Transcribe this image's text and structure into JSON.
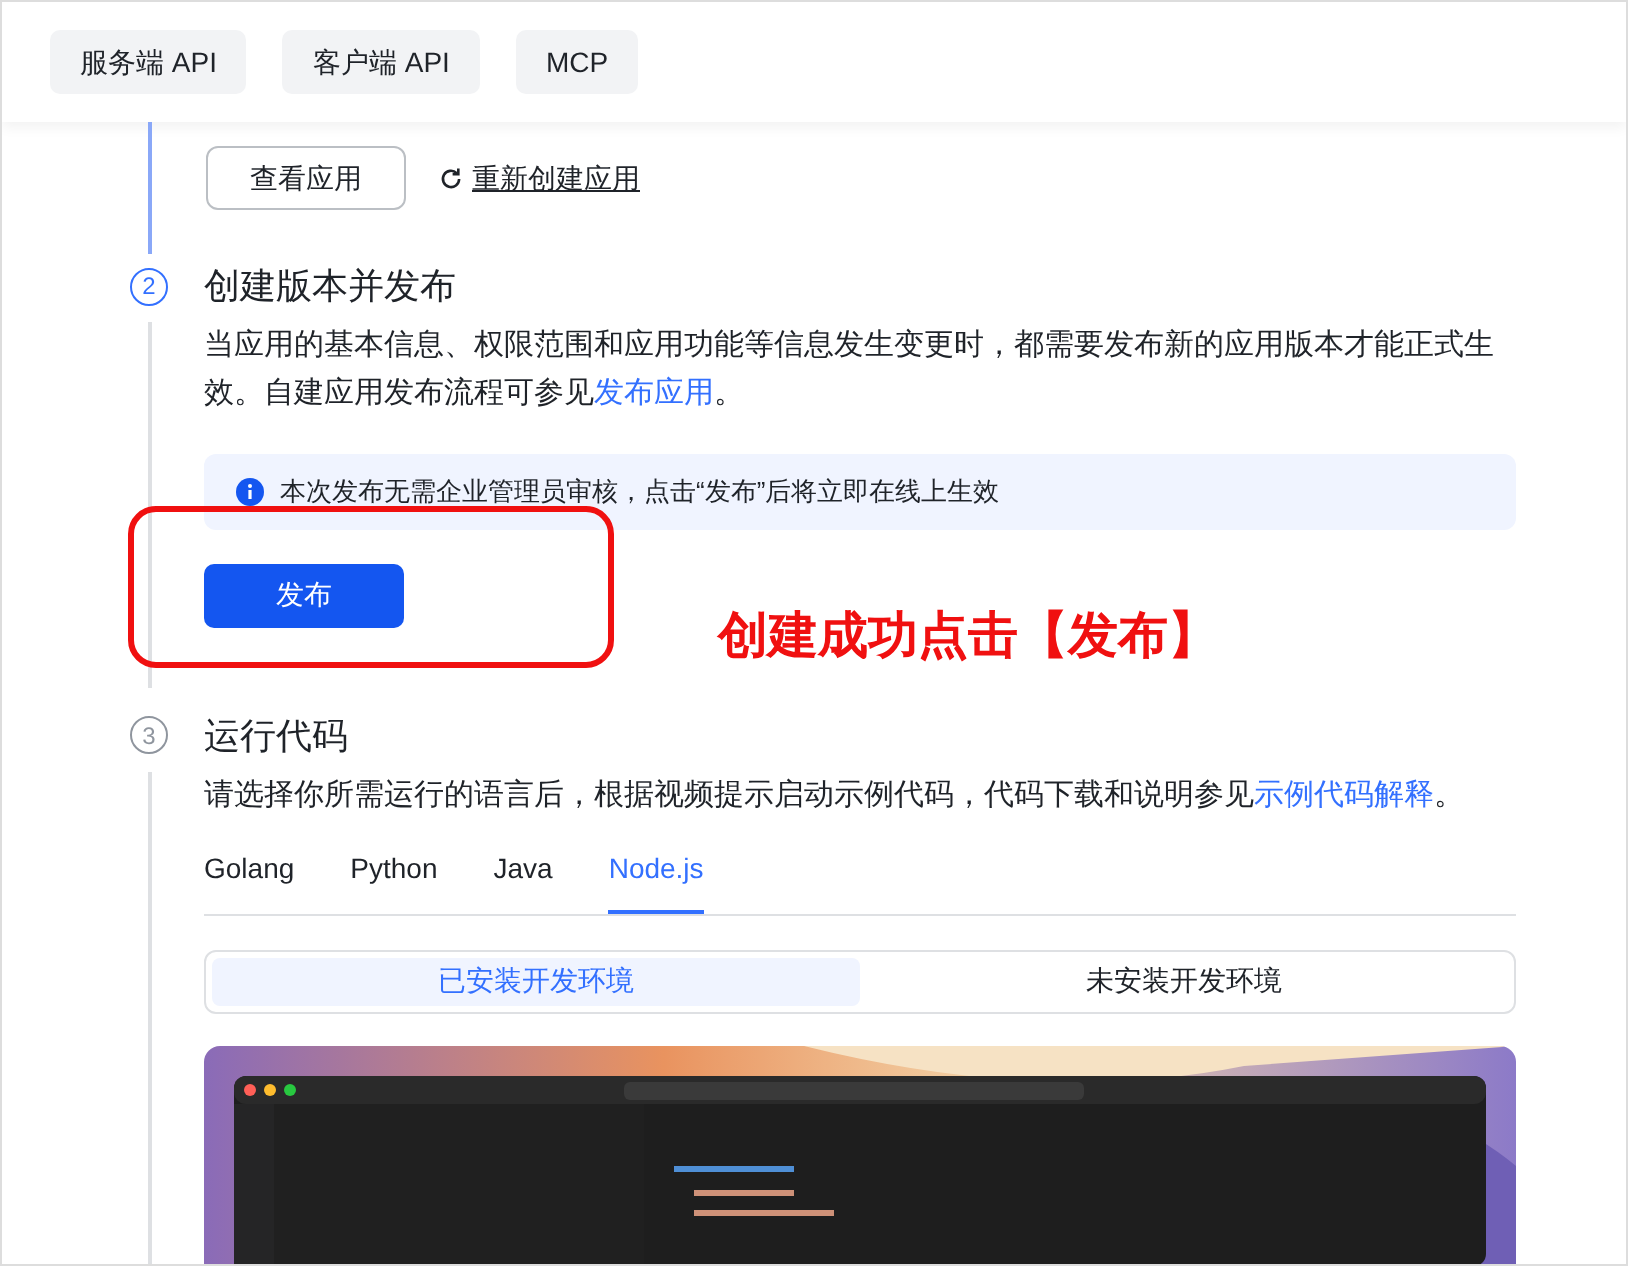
{
  "top_tabs": [
    {
      "label": "服务端 API",
      "selected": false
    },
    {
      "label": "客户端 API",
      "selected": false
    },
    {
      "label": "MCP",
      "selected": false
    }
  ],
  "step_1_tail": {
    "view_button": "查看应用",
    "recreate_link": "重新创建应用"
  },
  "steps": [
    {
      "number": "2",
      "active": true,
      "title": "创建版本并发布",
      "description": "当应用的基本信息、权限范围和应用功能等信息发生变更时，都需要发布新的应用版本才能正式生效。自建应用发布流程可参见",
      "link": "发布应用",
      "after": "。",
      "notice": "本次发布无需企业管理员审核，点击“发布”后将立即在线上生效",
      "publish_button": "发布"
    },
    {
      "number": "3",
      "active": false,
      "title": "运行代码",
      "description": "请选择你所需运行的语言后，根据视频提示启动示例代码，代码下载和说明参见",
      "link": "示例代码解释",
      "after": "。",
      "language_tabs": [
        {
          "label": "Golang",
          "selected": false
        },
        {
          "label": "Python",
          "selected": false
        },
        {
          "label": "Java",
          "selected": false
        },
        {
          "label": "Node.js",
          "selected": true
        }
      ],
      "env_tabs": [
        {
          "label": "已安装开发环境",
          "selected": true
        },
        {
          "label": "未安装开发环境",
          "selected": false
        }
      ],
      "video": {
        "kind": "picture"
      }
    }
  ],
  "annotation": {
    "text": "创建成功点击【发布】"
  }
}
